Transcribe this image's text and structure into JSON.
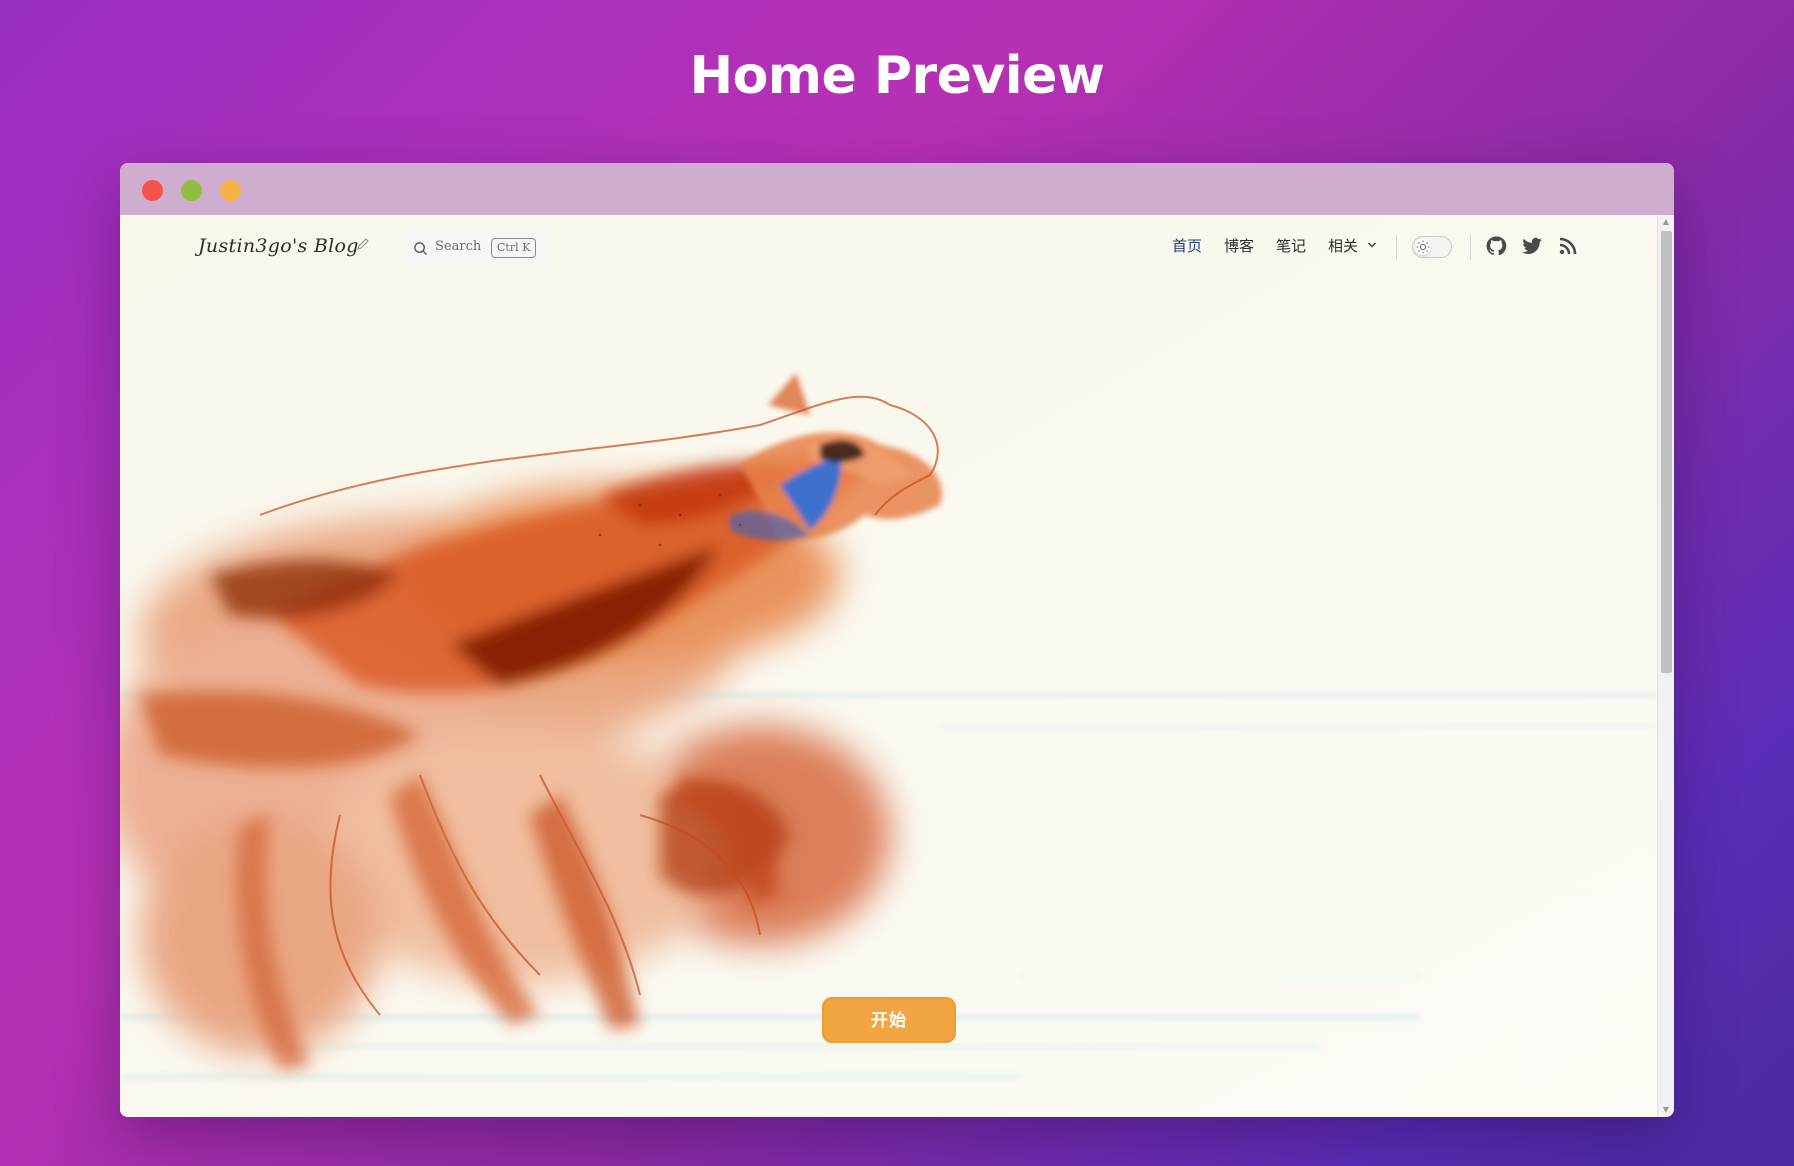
{
  "page": {
    "title": "Home Preview"
  },
  "window": {
    "traffic_lights": [
      {
        "name": "close",
        "color": "#f4524d"
      },
      {
        "name": "minimize",
        "color": "#8fbf3d"
      },
      {
        "name": "maximize",
        "color": "#f6b345"
      }
    ]
  },
  "site": {
    "brand": "Justin3go's Blog",
    "brand_icon": "pencil-icon",
    "search": {
      "label": "Search",
      "shortcut": "Ctrl K"
    },
    "nav": {
      "items": [
        {
          "label": "首页",
          "active": true
        },
        {
          "label": "博客",
          "active": false
        },
        {
          "label": "笔记",
          "active": false
        },
        {
          "label": "相关",
          "active": false,
          "dropdown": true
        }
      ]
    },
    "theme_toggle": {
      "mode": "light",
      "icon": "sun-icon"
    },
    "social": [
      {
        "icon": "github-icon"
      },
      {
        "icon": "twitter-icon"
      },
      {
        "icon": "rss-icon"
      }
    ],
    "hero": {
      "art": "running-wolf-ink-painting",
      "cta_label": "开始"
    }
  },
  "colors": {
    "accent": "#1e3f86",
    "cta": "#f0a540",
    "titlebar": "#cfadcf"
  }
}
